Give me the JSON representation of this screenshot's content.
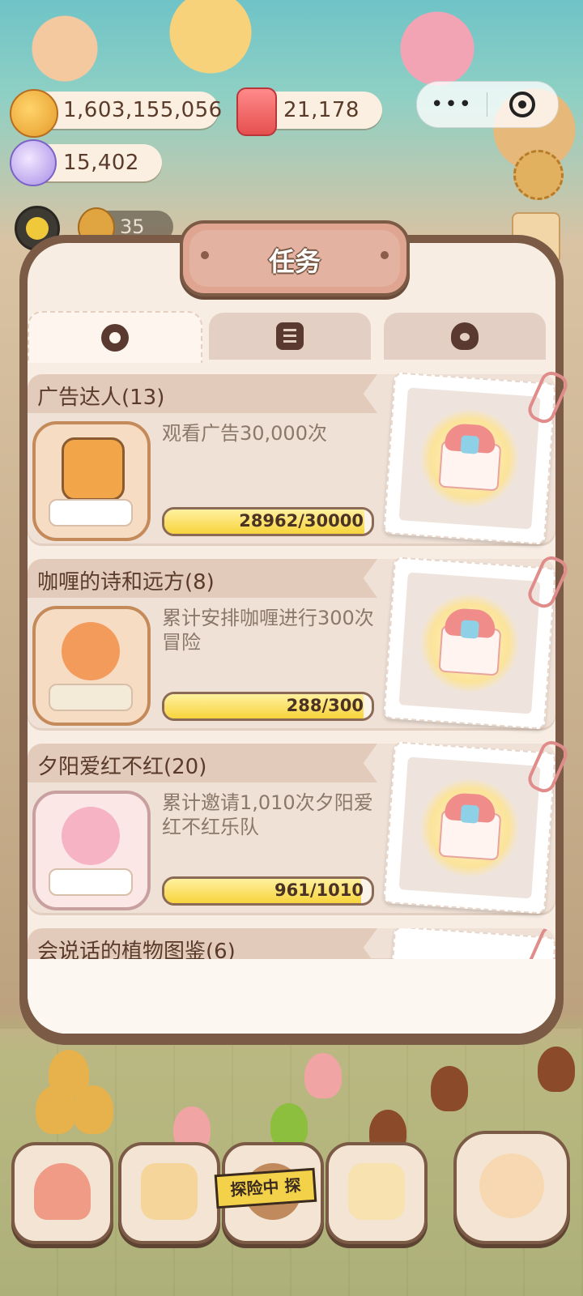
{
  "resources": {
    "coins": "1,603,155,056",
    "candles": "21,178",
    "gems": "15,402"
  },
  "hud": {
    "level": "35"
  },
  "panel": {
    "title": "任务",
    "tabs": [
      {
        "icon": "badge-icon",
        "selected": true
      },
      {
        "icon": "note-icon",
        "selected": false
      },
      {
        "icon": "bottle-icon",
        "selected": false
      }
    ]
  },
  "tasks": [
    {
      "name": "广告达人(13)",
      "desc": "观看广告30,000次",
      "progress_text": "28962/30000",
      "progress": 0.965
    },
    {
      "name": "咖喱的诗和远方(8)",
      "desc": "累计安排咖喱进行300次冒险",
      "progress_text": "288/300",
      "progress": 0.96
    },
    {
      "name": "夕阳爱红不红(20)",
      "desc": "累计邀请1,010次夕阳爱红不红乐队",
      "progress_text": "961/1010",
      "progress": 0.951
    },
    {
      "name": "会说话的植物图鉴(6)"
    }
  ],
  "bottom_nav": {
    "explore_label": "探险中 探"
  },
  "colors": {
    "panel_border": "#7b5a46",
    "progress_fill": "#f7d43c",
    "title_plate": "#dfa590"
  }
}
